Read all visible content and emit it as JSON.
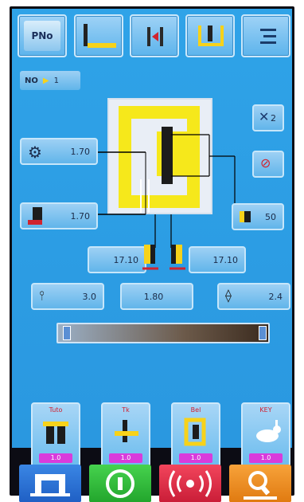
{
  "toolbar": {
    "b1": "PNo",
    "b2": "",
    "b3": "",
    "b4": "",
    "b5": ""
  },
  "no_indicator": {
    "label": "NO",
    "value": "1"
  },
  "thread": {
    "label": "1.70",
    "left_label": "1.70",
    "bottom_left": "17.10",
    "bottom_right": "17.10"
  },
  "right": {
    "r1": "2",
    "r2": "",
    "r3": "50"
  },
  "params": {
    "stitch": "3.0",
    "mid": "1.80",
    "speed": "2.4"
  },
  "patterns": [
    {
      "top": "Tuto",
      "bottom": "1.0"
    },
    {
      "top": "Tk",
      "bottom": "1.0"
    },
    {
      "top": "Bel",
      "bottom": "1.0"
    },
    {
      "top": "KEY",
      "bottom": "1.0"
    }
  ],
  "colors": {
    "panel": "#2c9de3",
    "green": "#2fba3a",
    "red": "#e4344a",
    "orange": "#f28c1d",
    "blue": "#2b6fd0",
    "magenta": "#d93bdc"
  }
}
